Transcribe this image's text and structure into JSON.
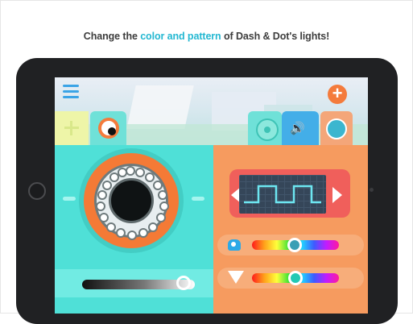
{
  "headline": {
    "before": "Change the ",
    "accent": "color and pattern",
    "after": " of Dash & Dot's lights!"
  },
  "colors": {
    "accent": "#24b8d2",
    "left_panel": "#4fe0d7",
    "right_panel": "#f69b5f",
    "plus_button": "#f47b3c"
  },
  "toolbar": {
    "menu_icon": "hamburger-icon",
    "add_icon": "plus-icon",
    "tools": [
      "crosshair-icon",
      "eye-icon",
      "disc-icon",
      "speaker-icon",
      "ring-icon"
    ]
  },
  "left_panel": {
    "eye_preview": "eye-led-ring",
    "brightness_level": 0.9
  },
  "right_panel": {
    "pattern": "square-wave",
    "eye_color_level": 0.55,
    "light_color_level": 0.55
  }
}
